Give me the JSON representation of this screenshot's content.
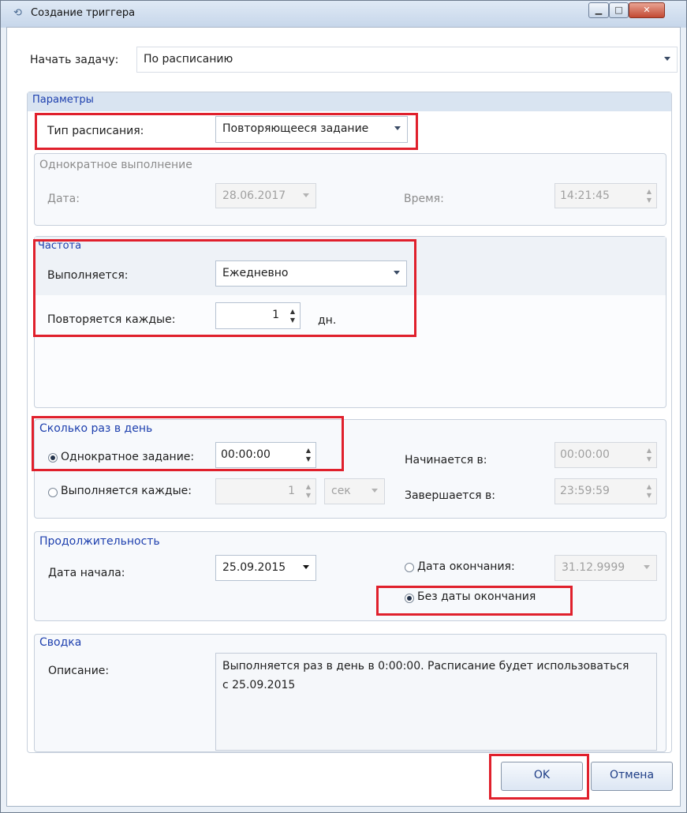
{
  "window": {
    "title": "Создание триггера"
  },
  "task": {
    "label": "Начать задачу:",
    "value": "По расписанию"
  },
  "params": {
    "header": "Параметры",
    "schedule_type": {
      "label": "Тип расписания:",
      "value": "Повторяющееся задание"
    }
  },
  "once": {
    "header": "Однократное выполнение",
    "date_label": "Дата:",
    "date_value": "28.06.2017",
    "time_label": "Время:",
    "time_value": "14:21:45"
  },
  "frequency": {
    "header": "Частота",
    "runs_label": "Выполняется:",
    "runs_value": "Ежедневно",
    "repeat_label": "Повторяется каждые:",
    "repeat_value": "1",
    "unit": "дн."
  },
  "daily": {
    "header": "Сколько раз в день",
    "single_label": "Однократное задание:",
    "single_value": "00:00:00",
    "every_label": "Выполняется каждые:",
    "every_value": "1",
    "every_unit": "сек",
    "start_label": "Начинается в:",
    "start_value": "00:00:00",
    "end_label": "Завершается в:",
    "end_value": "23:59:59"
  },
  "duration": {
    "header": "Продолжительность",
    "start_label": "Дата начала:",
    "start_value": "25.09.2015",
    "end_label": "Дата окончания:",
    "end_value": "31.12.9999",
    "no_end_label": "Без даты окончания"
  },
  "summary": {
    "header": "Сводка",
    "desc_label": "Описание:",
    "desc_line1": "Выполняется раз в день в 0:00:00. Расписание будет использоваться",
    "desc_line2": "с 25.09.2015"
  },
  "buttons": {
    "ok": "OK",
    "cancel": "Отмена"
  },
  "colors": {
    "highlight": "#e0202c",
    "group_text": "#1d3fae"
  }
}
